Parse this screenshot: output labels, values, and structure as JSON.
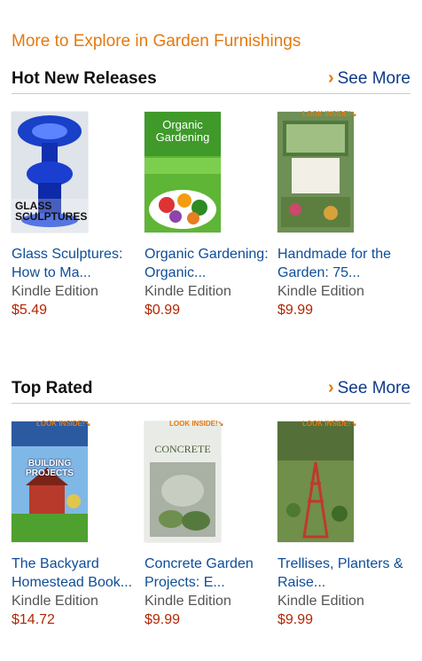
{
  "explore_title": "More to Explore in Garden Furnishings",
  "see_more_label": "See More",
  "sections": [
    {
      "title": "Hot New Releases",
      "items": [
        {
          "title": "Glass Sculptures: How to Ma...",
          "edition": "Kindle Edition",
          "price": "$5.49",
          "cover_text": "GLASS SCULPTURES",
          "look_inside": ""
        },
        {
          "title": "Organic Gardening: Organic...",
          "edition": "Kindle Edition",
          "price": "$0.99",
          "cover_text": "Organic Gardening",
          "look_inside": ""
        },
        {
          "title": "Handmade for the Garden: 75...",
          "edition": "Kindle Edition",
          "price": "$9.99",
          "cover_text": "",
          "look_inside": "LOOK INSIDE!"
        }
      ]
    },
    {
      "title": "Top Rated",
      "items": [
        {
          "title": "The Backyard Homestead Book...",
          "edition": "Kindle Edition",
          "price": "$14.72",
          "cover_text": "BUILDING PROJECTS",
          "look_inside": "LOOK INSIDE!"
        },
        {
          "title": "Concrete Garden Projects: E...",
          "edition": "Kindle Edition",
          "price": "$9.99",
          "cover_text": "CONCRETE",
          "look_inside": "LOOK INSIDE!"
        },
        {
          "title": "Trellises, Planters & Raise...",
          "edition": "Kindle Edition",
          "price": "$9.99",
          "cover_text": "",
          "look_inside": "LOOK INSIDE!"
        }
      ]
    }
  ],
  "colors": {
    "accent": "#e47911",
    "link": "#0e4d99",
    "price": "#b12704"
  }
}
